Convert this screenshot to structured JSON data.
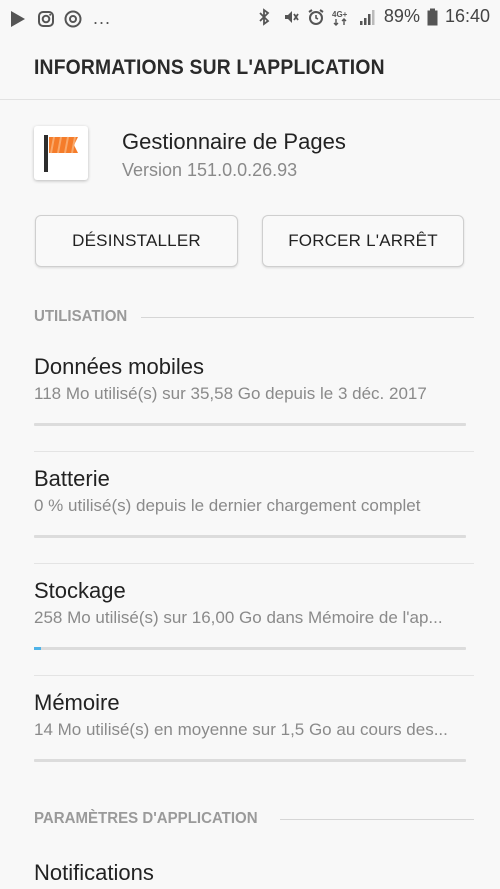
{
  "status_bar": {
    "left_icons": [
      "play-store-icon",
      "instagram-icon",
      "messenger-icon"
    ],
    "more": "...",
    "right_icons": [
      "bluetooth-icon",
      "mute-icon",
      "alarm-icon",
      "network-4g-icon",
      "signal-icon"
    ],
    "network_label": "4G+",
    "battery_percent": "89%",
    "time": "16:40"
  },
  "header": {
    "title": "INFORMATIONS SUR L'APPLICATION"
  },
  "app": {
    "name": "Gestionnaire de Pages",
    "version": "Version 151.0.0.26.93",
    "icon": "pages-manager-flag-icon"
  },
  "actions": {
    "uninstall_label": "DÉSINSTALLER",
    "force_stop_label": "FORCER L'ARRÊT"
  },
  "sections": {
    "usage_label": "UTILISATION",
    "app_settings_label": "PARAMÈTRES D'APPLICATION"
  },
  "usage_rows": [
    {
      "title": "Données mobiles",
      "subtitle": "118 Mo utilisé(s) sur 35,58 Go depuis le 3 déc. 2017",
      "fill_fraction": 0.0
    },
    {
      "title": "Batterie",
      "subtitle": "0 % utilisé(s) depuis le dernier chargement complet",
      "fill_fraction": 0.0
    },
    {
      "title": "Stockage",
      "subtitle": "258 Mo utilisé(s) sur 16,00 Go dans Mémoire de l'ap...",
      "fill_fraction": 0.016
    },
    {
      "title": "Mémoire",
      "subtitle": "14 Mo utilisé(s) en moyenne sur 1,5 Go au cours des...",
      "fill_fraction": 0.0
    }
  ],
  "settings_rows": [
    {
      "title": "Notifications"
    }
  ],
  "colors": {
    "accent": "#4fb3e8",
    "icon_orange": "#f57c2a"
  }
}
